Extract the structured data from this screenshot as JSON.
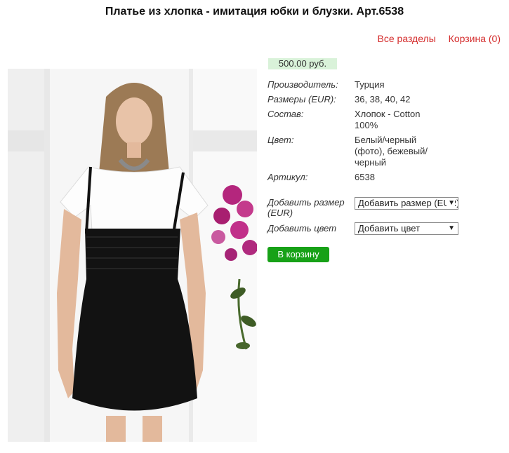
{
  "page": {
    "title": "Платье из хлопка - имитация юбки и блузки. Арт.6538"
  },
  "nav": {
    "all_sections": "Все разделы",
    "cart": "Корзина (0)"
  },
  "product": {
    "price": "500.00 руб.",
    "properties": [
      {
        "label": "Производитель:",
        "value": "Турция"
      },
      {
        "label": "Размеры (EUR):",
        "value": "36, 38, 40, 42"
      },
      {
        "label": "Состав:",
        "value": "Хлопок - Cotton 100%"
      },
      {
        "label": "Цвет:",
        "value": "Белый/черный (фото), бежевый/черный"
      },
      {
        "label": "Артикул:",
        "value": "6538"
      }
    ],
    "add_size_label": "Добавить размер (EUR)",
    "add_size_selected": "Добавить размер (EUR)",
    "add_color_label": "Добавить цвет",
    "add_color_selected": "Добавить цвет",
    "add_to_cart": "В корзину"
  },
  "colors": {
    "link": "#d42b2b",
    "price_bg": "#d9f2d9",
    "button": "#17a117"
  }
}
